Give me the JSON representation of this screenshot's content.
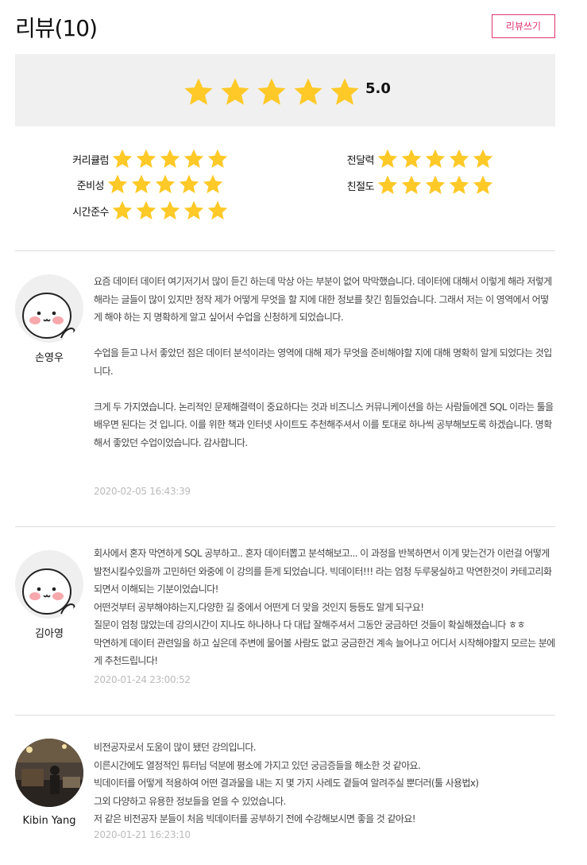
{
  "header": {
    "title": "리뷰(10)",
    "write_label": "리뷰쓰기"
  },
  "summary": {
    "rating": 5,
    "score_text": "5.0",
    "star_color": "#ffc928"
  },
  "criteria": [
    {
      "label": "커리큘럼",
      "rating": 5
    },
    {
      "label": "준비성",
      "rating": 5
    },
    {
      "label": "시간준수",
      "rating": 5
    },
    {
      "label": "전달력",
      "rating": 5
    },
    {
      "label": "친절도",
      "rating": 5
    }
  ],
  "reviews": [
    {
      "name": "손영우",
      "avatar": "cartoon-face-avatar",
      "text": "요즘 데이터 데이터 여기저기서 많이 듣긴 하는데 막상 아는 부분이 없어 막막했습니다. 데이터에 대해서 이렇게 해라 저렇게 해라는 글들이 많이 있지만 정작 제가 어떻게 무엇을 할 지에 대한 정보를 찾긴 힘들었습니다. 그래서 저는 이 영역에서 어떻게 해야 하는 지 명확하게 알고 싶어서 수업을 신청하게 되었습니다.\n\n수업을 듣고 나서 좋았던 점은 데이터 분석이라는 영역에 대해 제가 무엇을 준비해야할 지에 대해 명확히 알게 되었다는 것입니다.\n\n크게 두 가지였습니다. 논리적인 문제해결력이 중요하다는 것과 비즈니스 커뮤니케이션을 하는 사람들에겐 SQL 이라는 툴을 배우면 된다는 것 입니다. 이를 위한 책과 인터넷 사이트도 추천해주셔서 이를 토대로 하나씩 공부해보도록 하겠습니다. 명확해서 좋았던 수업이었습니다. 감사합니다.",
      "date": "2020-02-05 16:43:39"
    },
    {
      "name": "김아영",
      "avatar": "cartoon-face-avatar",
      "text": "회사에서 혼자 막연하게 SQL 공부하고.. 혼자 데이터뽑고 분석해보고... 이 과정을 반복하면서 이게 맞는건가 이런걸 어떻게 발전시킬수있을까 고민하던 와중에 이 강의를 듣게 되었습니다. 빅데이터!!! 라는 엄청 두루뭉실하고 막연한것이 카테고리화 되면서 이해되는 기분이었습니다!\n어떤것부터 공부해야하는지,다양한 길 중에서 어떤게 더 맞을 것인지 등등도 알게 되구요!\n질문이 엄청 많았는데 강의시간이 지나도 하나하나 다 대답 잘해주셔서 그동안 궁금하던 것들이 확실해졌습니다 ㅎㅎ\n막연하게 데이터 관련일을 하고 싶은데 주변에 물어볼 사람도 없고 궁금한건 계속 늘어나고 어디서 시작해야할지 모르는 분에게 추천드립니다!",
      "date": "2020-01-24 23:00:52"
    },
    {
      "name": "Kibin Yang",
      "avatar": "photo-avatar",
      "text": "비전공자로서 도움이 많이 됐던 강의입니다.\n이른시간에도 열정적인 튜터님 덕분에 평소에 가지고 있던 궁금증들을 해소한 것 같아요.\n빅데이터를 어떻게 적용하여 어떤 결과물을 내는 지 몇 가지 사례도 곁들여 알려주실 뿐더러(툴 사용법x)\n그외 다양하고 유용한 정보들을 얻을 수 있었습니다.\n저 같은 비전공자 분들이 처음 빅데이터를 공부하기 전에 수강해보시면 좋을 것 같아요!",
      "date": "2020-01-21 16:23:10"
    }
  ]
}
